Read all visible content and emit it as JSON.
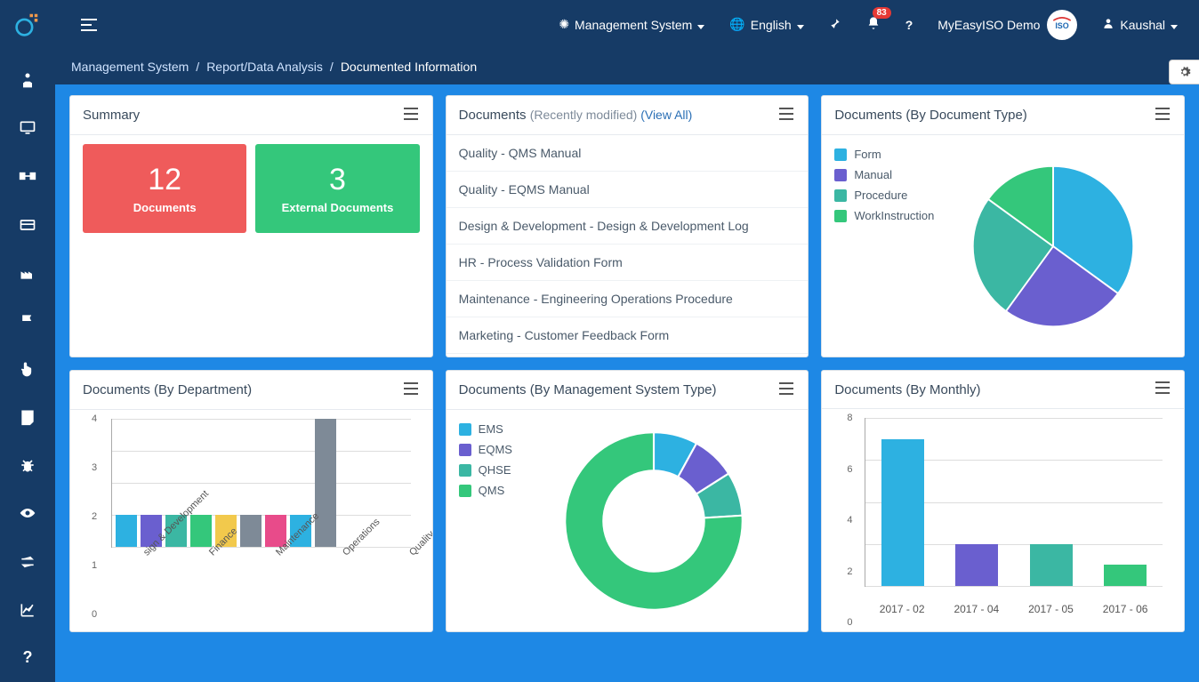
{
  "header": {
    "system_label": "Management System",
    "language_label": "English",
    "notification_count": "83",
    "brand_label": "MyEasyISO Demo",
    "user_label": "Kaushal",
    "help_icon": "?"
  },
  "breadcrumbs": {
    "items": [
      "Management System",
      "Report/Data Analysis",
      "Documented Information"
    ]
  },
  "cards": {
    "summary": {
      "title": "Summary",
      "tiles": [
        {
          "value": "12",
          "label": "Documents"
        },
        {
          "value": "3",
          "label": "External Documents"
        }
      ]
    },
    "recent": {
      "title": "Documents ",
      "subtitle": "(Recently modified) ",
      "view_all": "(View All)",
      "items": [
        "Quality - QMS Manual",
        "Quality - EQMS Manual",
        "Design & Development - Design & Development Log",
        "HR - Process Validation Form",
        "Maintenance - Engineering Operations Procedure",
        "Marketing - Customer Feedback Form"
      ]
    },
    "by_type": {
      "title": "Documents (By Document Type)"
    },
    "by_dept": {
      "title": "Documents (By Department)"
    },
    "by_mst": {
      "title": "Documents (By Management System Type)"
    },
    "by_month": {
      "title": "Documents (By Monthly)"
    }
  },
  "chart_data": [
    {
      "id": "by_type",
      "type": "pie",
      "series": [
        {
          "name": "Form",
          "value": 35,
          "color": "#2db1e1"
        },
        {
          "name": "Manual",
          "value": 25,
          "color": "#6a5fcf"
        },
        {
          "name": "Procedure",
          "value": 25,
          "color": "#3bb7a3"
        },
        {
          "name": "WorkInstruction",
          "value": 15,
          "color": "#34c77b"
        }
      ]
    },
    {
      "id": "by_dept",
      "type": "bar",
      "ylim": [
        0,
        4
      ],
      "yticks": [
        0,
        1,
        2,
        3,
        4
      ],
      "bars": [
        {
          "label": "sign & Development",
          "value": 1,
          "color": "#2db1e1"
        },
        {
          "label": "",
          "value": 1,
          "color": "#6a5fcf"
        },
        {
          "label": "Finance",
          "value": 1,
          "color": "#3bb7a3"
        },
        {
          "label": "",
          "value": 1,
          "color": "#34c77b"
        },
        {
          "label": "Maintenance",
          "value": 1,
          "color": "#f2c94c"
        },
        {
          "label": "",
          "value": 1,
          "color": "#7e8a97"
        },
        {
          "label": "Operations",
          "value": 1,
          "color": "#e84b8a"
        },
        {
          "label": "",
          "value": 1,
          "color": "#2db1e1"
        },
        {
          "label": "Quality",
          "value": 4,
          "color": "#7e8a97"
        }
      ]
    },
    {
      "id": "by_mst",
      "type": "donut",
      "series": [
        {
          "name": "EMS",
          "value": 8,
          "color": "#2db1e1"
        },
        {
          "name": "EQMS",
          "value": 8,
          "color": "#6a5fcf"
        },
        {
          "name": "QHSE",
          "value": 8,
          "color": "#3bb7a3"
        },
        {
          "name": "QMS",
          "value": 76,
          "color": "#34c77b"
        }
      ]
    },
    {
      "id": "by_month",
      "type": "bar",
      "ylim": [
        0,
        8
      ],
      "yticks": [
        0,
        2,
        4,
        6,
        8
      ],
      "bars": [
        {
          "label": "2017 - 02",
          "value": 7,
          "color": "#2db1e1"
        },
        {
          "label": "2017 - 04",
          "value": 2,
          "color": "#6a5fcf"
        },
        {
          "label": "2017 - 05",
          "value": 2,
          "color": "#3bb7a3"
        },
        {
          "label": "2017 - 06",
          "value": 1,
          "color": "#34c77b"
        }
      ]
    }
  ]
}
